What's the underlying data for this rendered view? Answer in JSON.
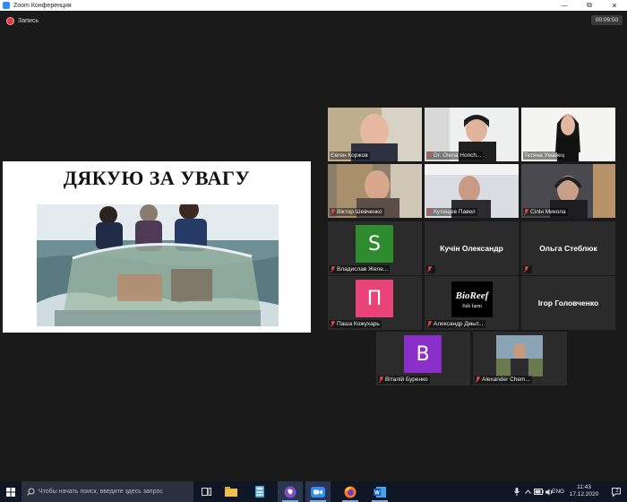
{
  "window": {
    "title": "Zoom Конференция"
  },
  "recording": {
    "label": "Запись"
  },
  "timer": {
    "value": "00:09:50"
  },
  "shared_screen": {
    "slide_title": "ДЯКУЮ ЗА УВАГУ"
  },
  "participants": [
    {
      "name": "Євген Коржов",
      "type": "video",
      "active": false
    },
    {
      "name": "Dr. Olena Honch...",
      "type": "video",
      "active": false
    },
    {
      "name": "Тетяна Уманец",
      "type": "video",
      "active": true
    },
    {
      "name": "Віктор Шевченко",
      "type": "video",
      "active": false
    },
    {
      "name": "Кутищев Павел",
      "type": "video",
      "active": false
    },
    {
      "name": "Сілін Микола",
      "type": "video",
      "active": false
    },
    {
      "name": "Владислав Желе...",
      "type": "avatar",
      "initial": "S",
      "color": "#2e8b2e"
    },
    {
      "name": "Кучін Олександр",
      "type": "text"
    },
    {
      "name": "Ольга Стеблюк",
      "type": "text"
    },
    {
      "name": "Паша Кожухарь",
      "type": "avatar",
      "initial": "П",
      "color": "#e8447a"
    },
    {
      "name": "Александр Дмыт...",
      "type": "logo",
      "logo_text": "BioReef fish farm"
    },
    {
      "name": "Ігор Головченко",
      "type": "text"
    },
    {
      "name": "Віталій Буренко",
      "type": "avatar",
      "initial": "В",
      "color": "#8b2fc9"
    },
    {
      "name": "Alexander Chem...",
      "type": "video"
    }
  ],
  "taskbar": {
    "search_placeholder": "Чтобы начать поиск, введите здесь запрос",
    "language": "ENG",
    "time": "11:43",
    "date": "17.12.2020",
    "notification_count": "2"
  },
  "colors": {
    "active_speaker": "#c6e33a",
    "recording": "#e03a3a",
    "zoom_blue": "#2d8cff"
  }
}
